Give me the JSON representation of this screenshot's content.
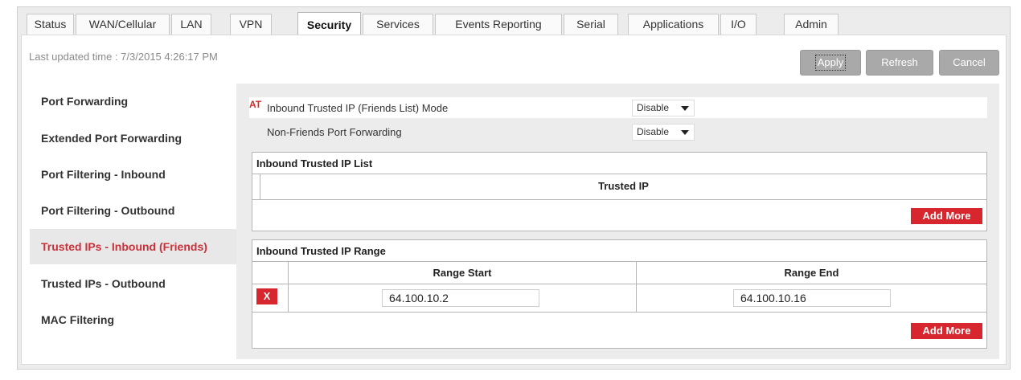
{
  "tabs": [
    {
      "label": "Status"
    },
    {
      "label": "WAN/Cellular"
    },
    {
      "label": "LAN"
    },
    {
      "label": "VPN"
    },
    {
      "label": "Security",
      "active": true
    },
    {
      "label": "Services"
    },
    {
      "label": "Events Reporting"
    },
    {
      "label": "Serial"
    },
    {
      "label": "Applications"
    },
    {
      "label": "I/O"
    },
    {
      "label": "Admin"
    }
  ],
  "header": {
    "last_updated": "Last updated time : 7/3/2015 4:26:17 PM"
  },
  "toolbar": {
    "apply_label": "Apply",
    "refresh_label": "Refresh",
    "cancel_label": "Cancel"
  },
  "sidebar": {
    "items": [
      {
        "label": "Port Forwarding"
      },
      {
        "label": "Extended Port Forwarding"
      },
      {
        "label": "Port Filtering - Inbound"
      },
      {
        "label": "Port Filtering - Outbound"
      },
      {
        "label": "Trusted IPs - Inbound (Friends)",
        "active": true
      },
      {
        "label": "Trusted IPs - Outbound"
      },
      {
        "label": "MAC Filtering"
      }
    ]
  },
  "settings": {
    "at_marker": "AT",
    "friends_mode": {
      "label": "Inbound Trusted IP (Friends List) Mode",
      "value": "Disable"
    },
    "non_friends": {
      "label": "Non-Friends Port Forwarding",
      "value": "Disable"
    }
  },
  "trusted_list": {
    "title": "Inbound Trusted IP List",
    "column": "Trusted IP",
    "add_label": "Add More"
  },
  "trusted_range": {
    "title": "Inbound Trusted IP Range",
    "col_start": "Range Start",
    "col_end": "Range End",
    "delete_label": "X",
    "rows": [
      {
        "start": "64.100.10.2",
        "end": "64.100.10.16"
      }
    ],
    "add_label": "Add More"
  },
  "colors": {
    "accent_red": "#d7262d",
    "active_text": "#c8313a"
  }
}
